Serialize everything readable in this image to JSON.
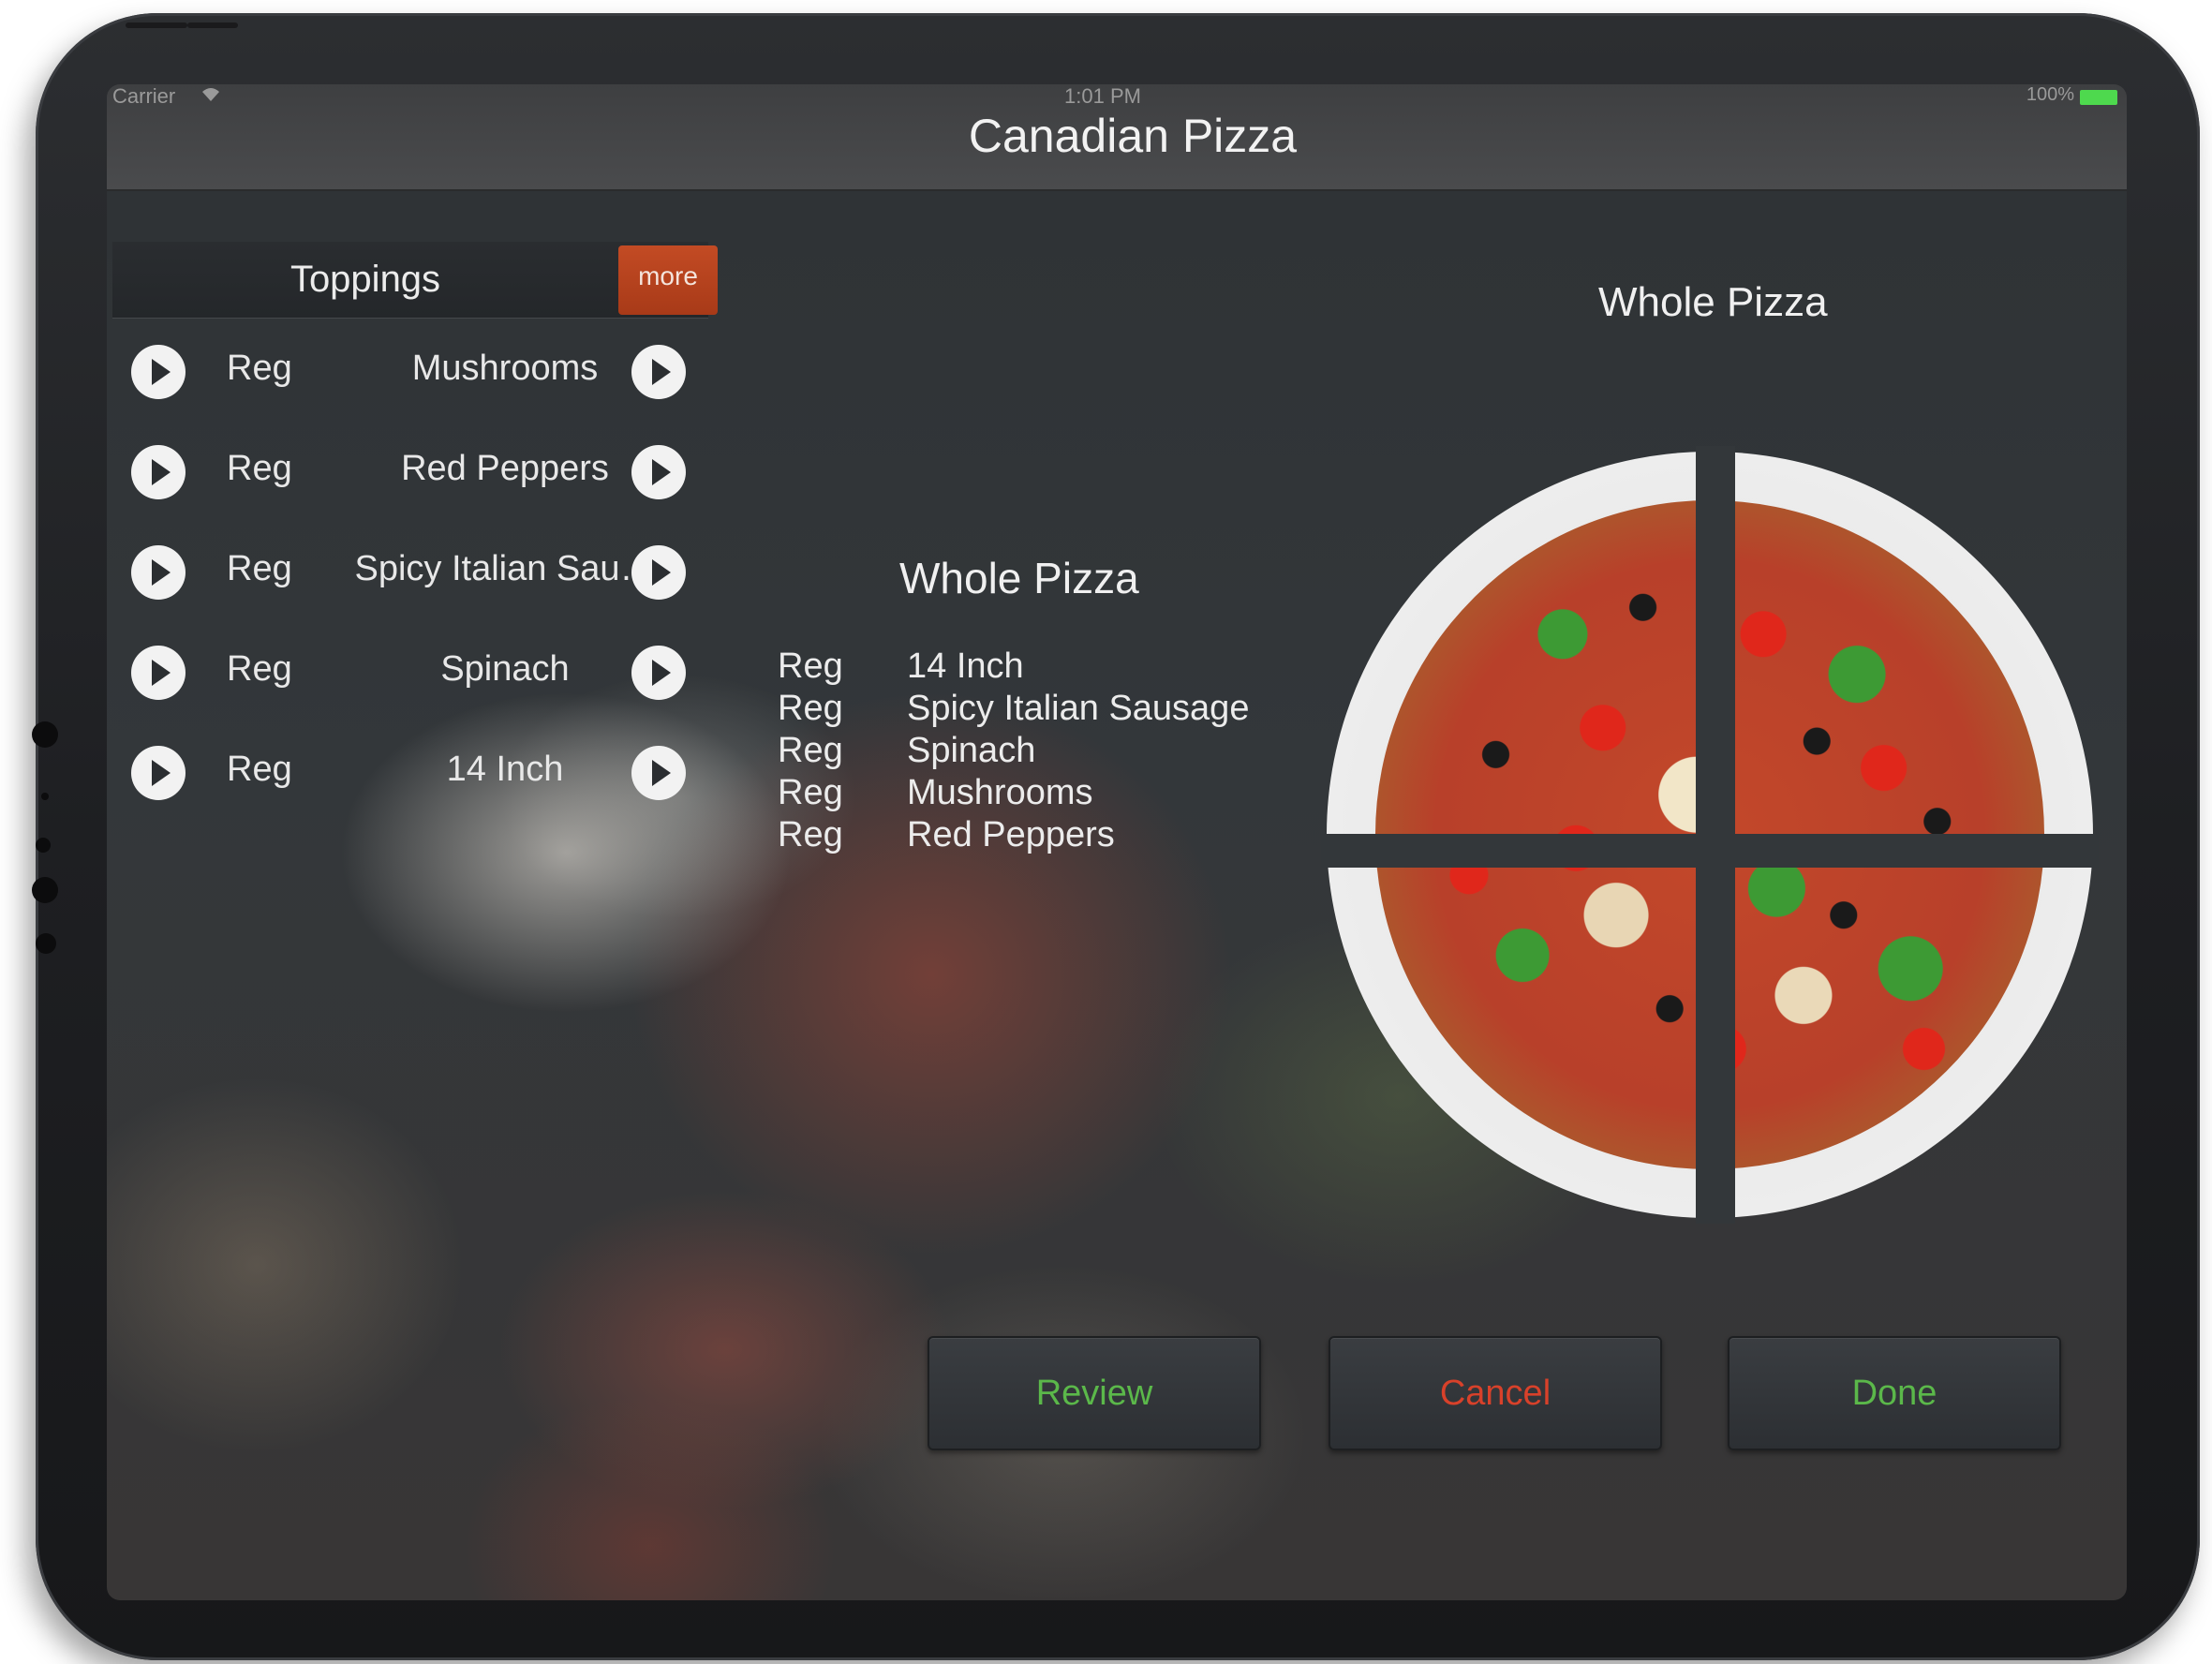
{
  "status_bar": {
    "carrier": "Carrier",
    "time": "1:01 PM",
    "battery_label": "100%",
    "wifi_icon": "wifi-icon",
    "battery_color": "#4ed94e"
  },
  "nav": {
    "title": "Canadian Pizza"
  },
  "toppings": {
    "header": "Toppings",
    "more_label": "more",
    "rows": [
      {
        "portion": "Reg",
        "name": "Mushrooms"
      },
      {
        "portion": "Reg",
        "name": "Red Peppers"
      },
      {
        "portion": "Reg",
        "name": "Spicy Italian Sau…"
      },
      {
        "portion": "Reg",
        "name": "Spinach"
      },
      {
        "portion": "Reg",
        "name": "14 Inch"
      }
    ]
  },
  "summary": {
    "title": "Whole Pizza",
    "items": [
      {
        "portion": "Reg",
        "name": "14 Inch"
      },
      {
        "portion": "Reg",
        "name": "Spicy Italian Sausage"
      },
      {
        "portion": "Reg",
        "name": "Spinach"
      },
      {
        "portion": "Reg",
        "name": "Mushrooms"
      },
      {
        "portion": "Reg",
        "name": "Red Peppers"
      }
    ]
  },
  "pizza": {
    "title": "Whole Pizza"
  },
  "actions": {
    "review": "Review",
    "cancel": "Cancel",
    "done": "Done"
  },
  "colors": {
    "more_button": "#c34b24",
    "review_done_text": "#5bb84a",
    "cancel_text": "#d8412a"
  }
}
